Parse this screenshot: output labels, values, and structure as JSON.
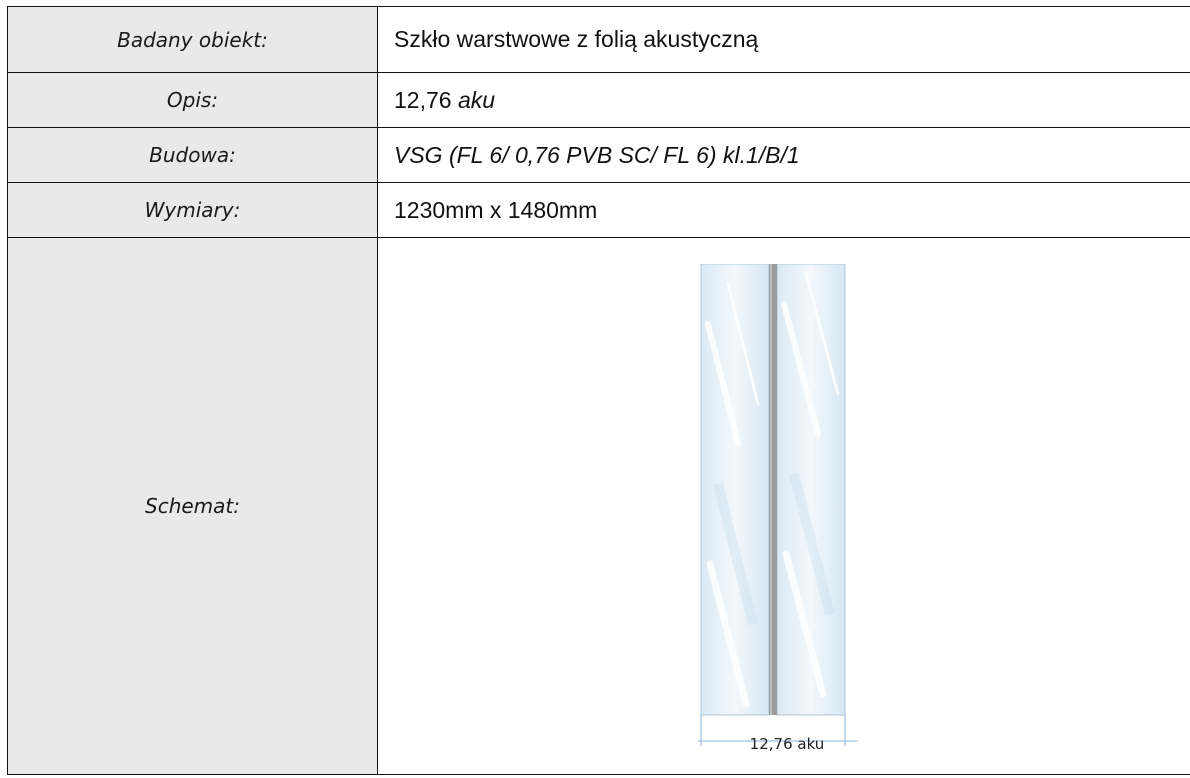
{
  "rows": [
    {
      "label": "Badany obiekt:",
      "value": "Szkło warstwowe z folią akustyczną"
    },
    {
      "label": "Opis:",
      "value_plain": "12,76",
      "value_italic": "aku"
    },
    {
      "label": "Budowa:",
      "value": "VSG (FL 6/ 0,76 PVB SC/ FL 6) kl.1/B/1"
    },
    {
      "label": "Wymiary:",
      "value": "1230mm x 1480mm"
    },
    {
      "label": "Schemat:"
    }
  ],
  "diagram": {
    "dimension_label": "12,76 aku",
    "icon": "laminated-glass-cross-section",
    "colors": {
      "glass": "#e6f1f8",
      "glass_edge": "#a9c7dc",
      "interlayer": "#9a9a9a",
      "dimension_line": "#8fb0d6",
      "label_fill": "#e9e9e9",
      "border": "#111111"
    }
  }
}
